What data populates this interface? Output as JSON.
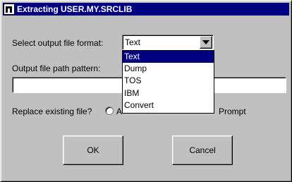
{
  "window": {
    "title": "Extracting USER.MY.SRCLIB"
  },
  "format": {
    "label": "Select output file format:",
    "selected": "Text",
    "options": [
      "Text",
      "Dump",
      "TOS",
      "IBM",
      "Convert"
    ]
  },
  "path": {
    "label": "Output file path pattern:",
    "value": ""
  },
  "replace": {
    "label": "Replace existing file?",
    "options": [
      "A",
      "Prompt"
    ]
  },
  "buttons": {
    "ok": "OK",
    "cancel": "Cancel"
  },
  "colors": {
    "titlebar": "#000080",
    "selection": "#000080",
    "face": "#c0c0c0"
  }
}
